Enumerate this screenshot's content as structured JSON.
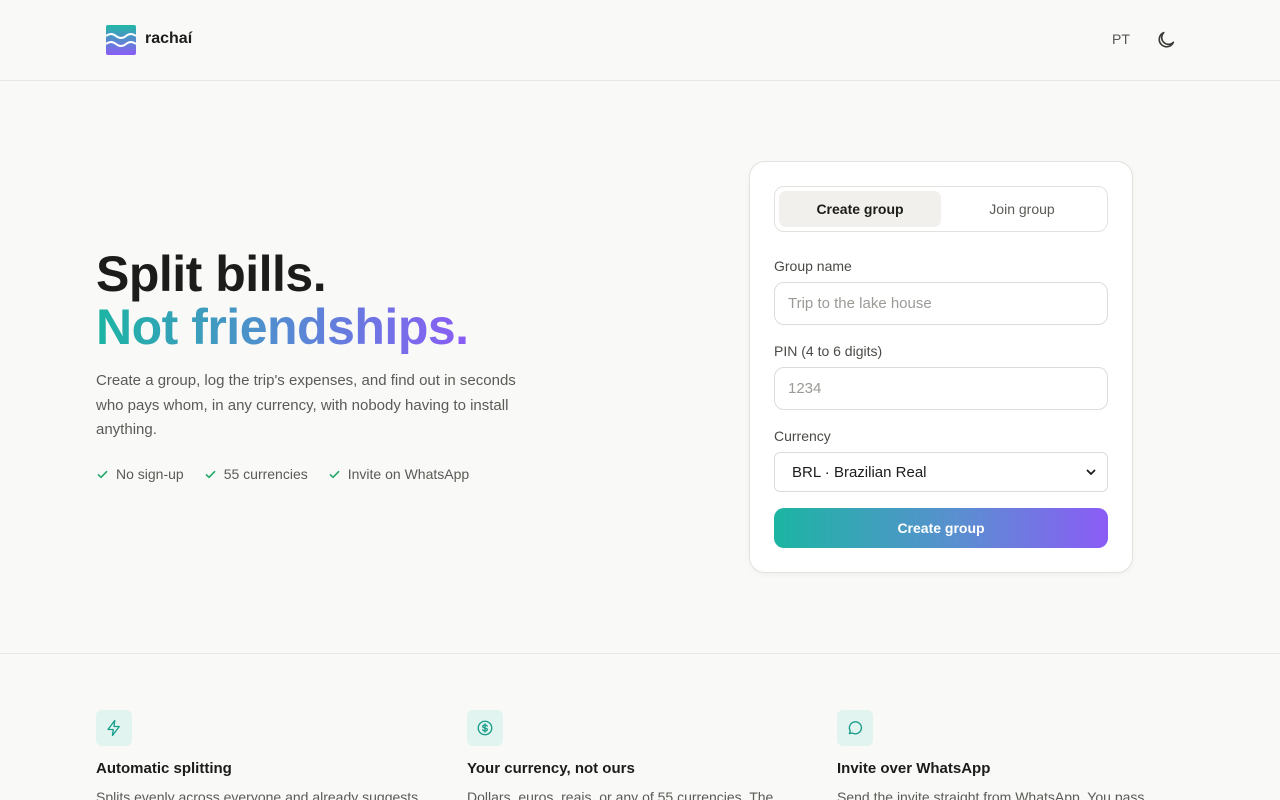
{
  "header": {
    "brand": "rachaí",
    "lang": "PT"
  },
  "hero": {
    "title_line1": "Split bills.",
    "title_line2": "Not friendships.",
    "subtitle": "Create a group, log the trip's expenses, and find out in seconds who pays whom, in any currency, with nobody having to install anything.",
    "checks": [
      "No sign-up",
      "55 currencies",
      "Invite on WhatsApp"
    ]
  },
  "form": {
    "tabs": [
      "Create group",
      "Join group"
    ],
    "active_tab": "Create group",
    "group_name_label": "Group name",
    "group_name_placeholder": "Trip to the lake house",
    "pin_label": "PIN (4 to 6 digits)",
    "pin_placeholder": "1234",
    "currency_label": "Currency",
    "currency_value": "BRL · Brazilian Real",
    "submit_label": "Create group"
  },
  "features": [
    {
      "icon": "lightning-icon",
      "title": "Automatic splitting",
      "desc": "Splits evenly across everyone and already suggests"
    },
    {
      "icon": "dollar-coin-icon",
      "title": "Your currency, not ours",
      "desc": "Dollars, euros, reais, or any of 55 currencies. The"
    },
    {
      "icon": "chat-bubble-icon",
      "title": "Invite over WhatsApp",
      "desc": "Send the invite straight from WhatsApp. You pass"
    }
  ],
  "colors": {
    "accent_teal": "#1cb5a3",
    "accent_violet": "#8b5cf6",
    "check_green": "#22a86b"
  }
}
